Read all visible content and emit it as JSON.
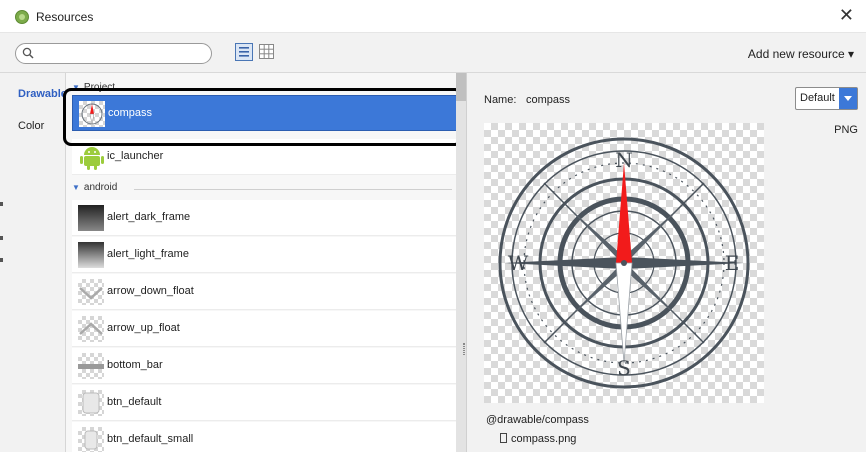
{
  "window": {
    "title": "Resources",
    "close_label": "✕"
  },
  "toolbar": {
    "search": {
      "value": "",
      "placeholder": ""
    },
    "add_resource_label": "Add new resource ▾"
  },
  "nav": [
    {
      "label": "Drawable"
    },
    {
      "label": "Color"
    }
  ],
  "groups": [
    {
      "label": "Project"
    },
    {
      "label": "android"
    }
  ],
  "resources": [
    {
      "name": "compass"
    },
    {
      "name": "ic_launcher"
    },
    {
      "name": "alert_dark_frame"
    },
    {
      "name": "alert_light_frame"
    },
    {
      "name": "arrow_down_float"
    },
    {
      "name": "arrow_up_float"
    },
    {
      "name": "bottom_bar"
    },
    {
      "name": "btn_default"
    },
    {
      "name": "btn_default_small"
    }
  ],
  "preview": {
    "name_label": "Name:",
    "name_value": "compass",
    "density": "Default",
    "format": "PNG",
    "compass_letters": {
      "n": "N",
      "s": "S",
      "e": "E",
      "w": "W"
    },
    "resource_ref": "@drawable/compass",
    "file_name": "compass.png"
  },
  "colors": {
    "selection": "#3c78d8",
    "nav_active": "#2f5fc2",
    "needle_red": "#f21b1b",
    "compass_stroke": "#4a535c"
  },
  "icons": [
    "search-icon",
    "list-view-icon",
    "grid-view-icon",
    "close-icon",
    "android-icon",
    "file-icon"
  ]
}
